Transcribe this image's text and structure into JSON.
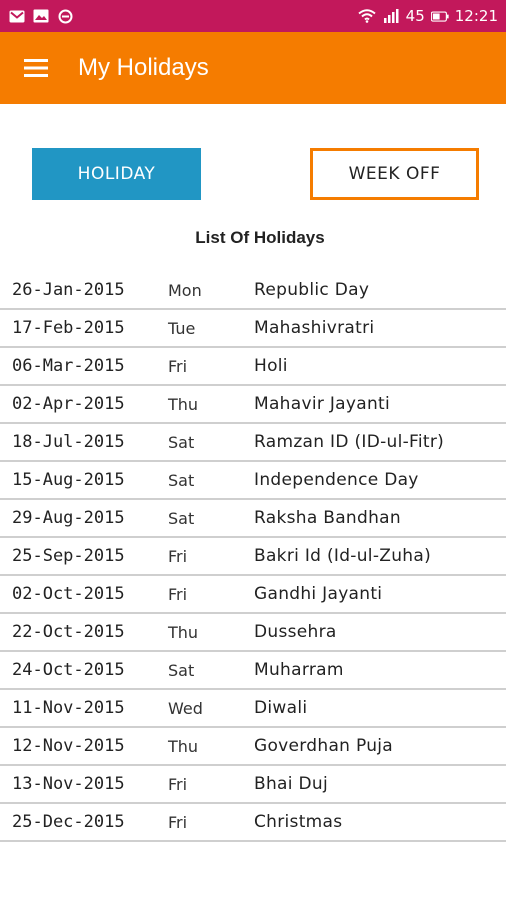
{
  "status_bar": {
    "battery": "45",
    "time": "12:21",
    "bg_color": "#c2185b"
  },
  "app_bar": {
    "title": "My Holidays",
    "bg_color": "#f57c00"
  },
  "tabs": {
    "holiday_label": "HOLIDAY",
    "weekoff_label": "WEEK OFF",
    "holiday_color": "#2196c4"
  },
  "list_title": "List Of Holidays",
  "holidays": [
    {
      "date": "26-Jan-2015",
      "day": "Mon",
      "name": "Republic Day"
    },
    {
      "date": "17-Feb-2015",
      "day": "Tue",
      "name": "Mahashivratri"
    },
    {
      "date": "06-Mar-2015",
      "day": "Fri",
      "name": "Holi"
    },
    {
      "date": "02-Apr-2015",
      "day": "Thu",
      "name": "Mahavir Jayanti"
    },
    {
      "date": "18-Jul-2015",
      "day": "Sat",
      "name": "Ramzan ID (ID-ul-Fitr)"
    },
    {
      "date": "15-Aug-2015",
      "day": "Sat",
      "name": "Independence Day"
    },
    {
      "date": "29-Aug-2015",
      "day": "Sat",
      "name": "Raksha Bandhan"
    },
    {
      "date": "25-Sep-2015",
      "day": "Fri",
      "name": "Bakri Id (Id-ul-Zuha)"
    },
    {
      "date": "02-Oct-2015",
      "day": "Fri",
      "name": "Gandhi Jayanti"
    },
    {
      "date": "22-Oct-2015",
      "day": "Thu",
      "name": "Dussehra"
    },
    {
      "date": "24-Oct-2015",
      "day": "Sat",
      "name": "Muharram"
    },
    {
      "date": "11-Nov-2015",
      "day": "Wed",
      "name": "Diwali"
    },
    {
      "date": "12-Nov-2015",
      "day": "Thu",
      "name": "Goverdhan Puja"
    },
    {
      "date": "13-Nov-2015",
      "day": "Fri",
      "name": "Bhai Duj"
    },
    {
      "date": "25-Dec-2015",
      "day": "Fri",
      "name": "Christmas"
    }
  ]
}
